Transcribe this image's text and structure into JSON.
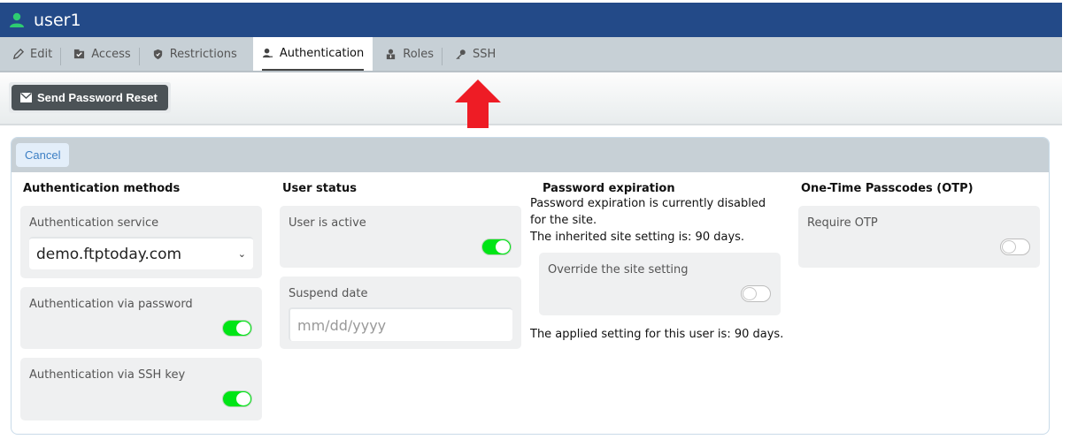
{
  "window": {
    "title": "user1",
    "user_icon": "user-icon"
  },
  "tabs": [
    {
      "label": "Edit",
      "icon": "pencil-icon",
      "active": false
    },
    {
      "label": "Access",
      "icon": "folder-check-icon",
      "active": false
    },
    {
      "label": "Restrictions",
      "icon": "shield-icon",
      "active": false
    },
    {
      "label": "Authentication",
      "icon": "user-key-icon",
      "active": true
    },
    {
      "label": "Roles",
      "icon": "person-tie-icon",
      "active": false
    },
    {
      "label": "SSH",
      "icon": "key-icon",
      "active": false
    }
  ],
  "toolbar": {
    "send_reset_label": "Send Password Reset",
    "send_reset_icon": "envelope-icon"
  },
  "annotation": {
    "type": "red-arrow-up",
    "color": "#ee1c25",
    "points_to": "SSH tab"
  },
  "panel": {
    "cancel_label": "Cancel",
    "auth_methods": {
      "heading": "Authentication methods",
      "service_label": "Authentication service",
      "service_value": "demo.ftptoday.com",
      "password_label": "Authentication via password",
      "password_enabled": true,
      "sshkey_label": "Authentication via SSH key",
      "sshkey_enabled": true
    },
    "user_status": {
      "heading": "User status",
      "active_label": "User is active",
      "active_enabled": true,
      "suspend_label": "Suspend date",
      "suspend_placeholder": "mm/dd/yyyy"
    },
    "password_expiration": {
      "heading": "Password expiration",
      "line1": "Password expiration is currently disabled for the site.",
      "line2": "The inherited site setting is: 90 days.",
      "override_label": "Override the site setting",
      "override_enabled": false,
      "applied": "The applied setting for this user is: 90 days."
    },
    "otp": {
      "heading": "One-Time Passcodes (OTP)",
      "require_label": "Require OTP",
      "require_enabled": false
    }
  },
  "colors": {
    "header": "#234a88",
    "toggle_on": "#00e516",
    "user_icon": "#2ecc71",
    "cancel_text": "#3c7fc4"
  }
}
